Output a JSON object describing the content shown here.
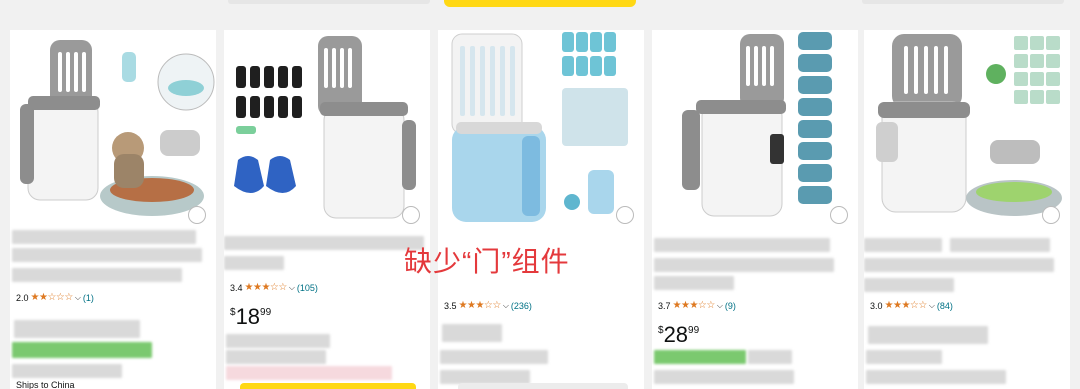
{
  "annotation": "缺少“门”组件",
  "products": [
    {
      "rating": "2.0",
      "stars": "★★☆☆☆",
      "count": "(1)",
      "price_symbol": "",
      "price_whole": "",
      "price_cents": "",
      "ships": "Ships to China"
    },
    {
      "rating": "3.4",
      "stars": "★★★☆☆",
      "count": "(105)",
      "price_symbol": "$",
      "price_whole": "18",
      "price_cents": "99",
      "ships": ""
    },
    {
      "rating": "3.5",
      "stars": "★★★☆☆",
      "count": "(236)",
      "price_symbol": "",
      "price_whole": "",
      "price_cents": "",
      "ships": ""
    },
    {
      "rating": "3.7",
      "stars": "★★★☆☆",
      "count": "(9)",
      "price_symbol": "$",
      "price_whole": "28",
      "price_cents": "99",
      "ships": ""
    },
    {
      "rating": "3.0",
      "stars": "★★★☆☆",
      "count": "(84)",
      "price_symbol": "",
      "price_whole": "",
      "price_cents": "",
      "ships": ""
    }
  ],
  "colors": {
    "star": "#de7921",
    "link": "#007185",
    "annotation": "#e4393c",
    "button": "#ffd814"
  }
}
